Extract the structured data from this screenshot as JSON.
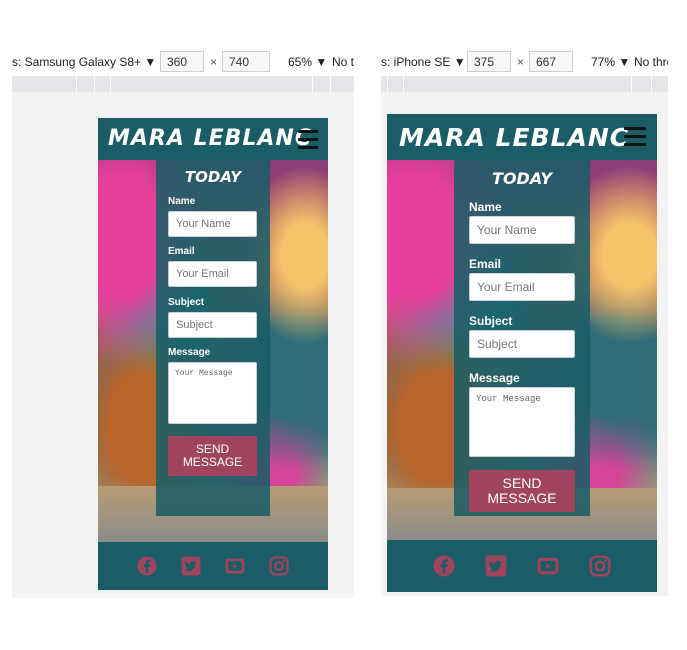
{
  "devtools": [
    {
      "device_label": "s: Samsung Galaxy S8+ ▼",
      "width": "360",
      "height": "740",
      "zoom": "65% ▼",
      "throttle": "No th"
    },
    {
      "device_label": "s: iPhone SE ▼",
      "width": "375",
      "height": "667",
      "zoom": "77% ▼",
      "throttle": "No thro"
    }
  ],
  "site": {
    "brand": "MARA LEBLANC",
    "form_heading": "TODAY",
    "fields": {
      "name_label": "Name",
      "name_placeholder": "Your Name",
      "email_label": "Email",
      "email_placeholder": "Your Email",
      "subject_label": "Subject",
      "subject_placeholder": "Subject",
      "message_label": "Message",
      "message_placeholder": "Your Message"
    },
    "send_button": "SEND MESSAGE",
    "social_icons": [
      "facebook-icon",
      "twitter-icon",
      "youtube-icon",
      "instagram-icon"
    ],
    "colors": {
      "primary": "#1b5d66",
      "button": "#a0435c",
      "icon": "#a0435c"
    }
  },
  "misc": {
    "times": "×"
  }
}
